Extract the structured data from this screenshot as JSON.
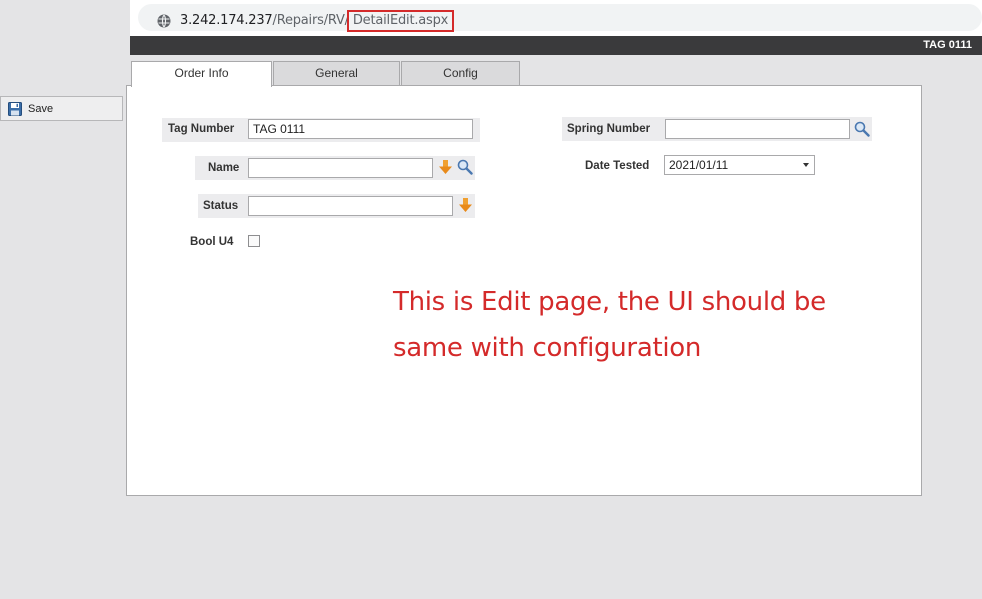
{
  "browser": {
    "url_host": "3.242.174.237",
    "url_path": "/Repairs/RV/",
    "url_highlight": "DetailEdit.aspx"
  },
  "header": {
    "title": "TAG 0111"
  },
  "toolbar": {
    "save_label": "Save"
  },
  "tabs": [
    {
      "label": "Order Info",
      "active": true
    },
    {
      "label": "General",
      "active": false
    },
    {
      "label": "Config",
      "active": false
    }
  ],
  "form": {
    "tag_number": {
      "label": "Tag Number",
      "value": "TAG 0111"
    },
    "name": {
      "label": "Name",
      "value": ""
    },
    "status": {
      "label": "Status",
      "value": ""
    },
    "bool_u4": {
      "label": "Bool U4",
      "checked": false
    },
    "spring_number": {
      "label": "Spring Number",
      "value": ""
    },
    "date_tested": {
      "label": "Date Tested",
      "value": "2021/01/11"
    }
  },
  "annotation": {
    "text": "This is Edit page, the UI should be same with configuration",
    "color": "#d42a2a"
  },
  "colors": {
    "header_bar": "#3a3a3c",
    "accent_icon": "#f0a030",
    "background": "#e4e4e6"
  }
}
